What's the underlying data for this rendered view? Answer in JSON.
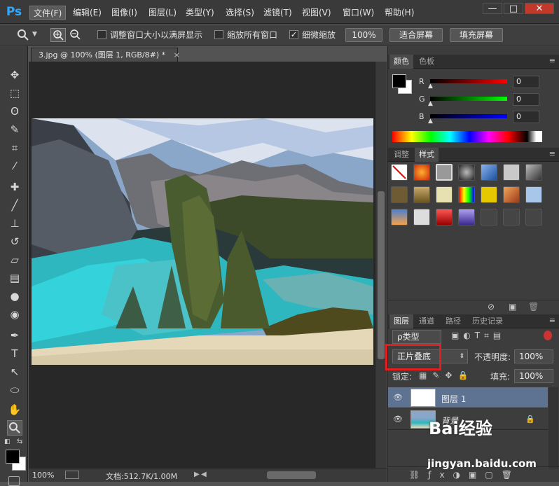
{
  "app": {
    "logo": "Ps"
  },
  "menubar": {
    "items": [
      "文件(F)",
      "编辑(E)",
      "图像(I)",
      "图层(L)",
      "类型(Y)",
      "选择(S)",
      "滤镜(T)",
      "视图(V)",
      "窗口(W)",
      "帮助(H)"
    ],
    "window_controls": [
      "—",
      "□",
      "✕"
    ]
  },
  "options": {
    "zoom_tool_icon": "zoom-icon",
    "chk1_label": "调整窗口大小以满屏显示",
    "chk2_label": "缩放所有窗口",
    "chk3_label": "细微缩放",
    "chk1": false,
    "chk2": false,
    "chk3": true,
    "btn_100": "100%",
    "btn_fit": "适合屏幕",
    "btn_fill": "填充屏幕"
  },
  "document": {
    "tab_title": "3.jpg @ 100% (图层 1, RGB/8#) *",
    "close": "×"
  },
  "status": {
    "zoom": "100%",
    "doc_info": "文档:512.7K/1.00M"
  },
  "color_panel": {
    "tabs": [
      "颜色",
      "色板"
    ],
    "r_label": "R",
    "g_label": "G",
    "b_label": "B",
    "r": "0",
    "g": "0",
    "b": "0",
    "fg_color": "#000000",
    "bg_color": "#ffffff"
  },
  "styles_panel": {
    "tabs": [
      "调整",
      "样式"
    ]
  },
  "layers_panel": {
    "tabs": [
      "图层",
      "通道",
      "路径",
      "历史记录"
    ],
    "filter_label": "ρ类型",
    "blend_mode": "正片叠底",
    "opacity_label": "不透明度:",
    "opacity_value": "100%",
    "lock_label": "锁定:",
    "fill_label": "填充:",
    "fill_value": "100%",
    "layers": [
      {
        "name": "图层 1",
        "selected": true
      },
      {
        "name": "背景",
        "selected": false,
        "locked": true
      }
    ]
  },
  "watermark": {
    "brand": "Bai经验",
    "url": "jingyan.baidu.com"
  },
  "colors": {
    "accent_highlight": "#e02020",
    "selected_layer": "#5d7391",
    "ps_blue": "#31a8ff"
  }
}
